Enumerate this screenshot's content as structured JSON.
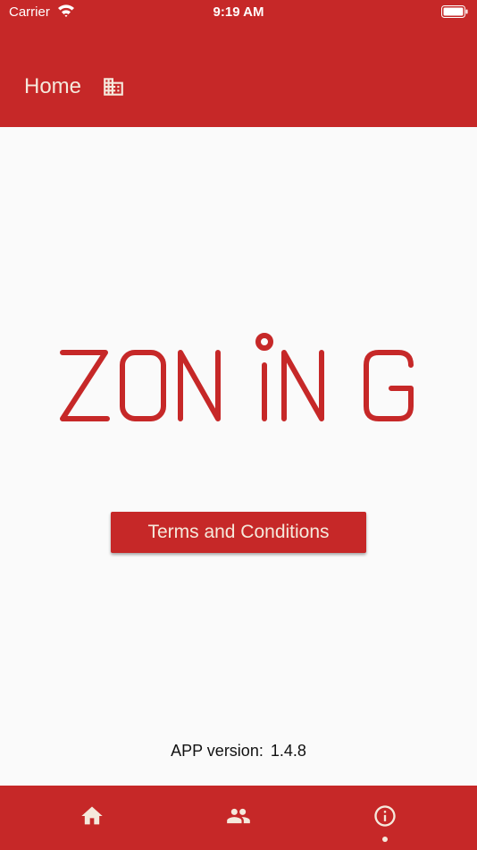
{
  "status_bar": {
    "carrier": "Carrier",
    "time": "9:19 AM"
  },
  "app_bar": {
    "title": "Home",
    "title_icon": "building-icon"
  },
  "logo": {
    "text": "ZONiNG",
    "color": "#c62828"
  },
  "terms_button": {
    "label": "Terms and Conditions"
  },
  "version": {
    "label": "APP version:",
    "value": "1.4.8"
  },
  "bottom_nav": {
    "items": [
      {
        "icon": "home-icon",
        "selected": false
      },
      {
        "icon": "people-icon",
        "selected": false
      },
      {
        "icon": "info-icon",
        "selected": true
      }
    ]
  },
  "colors": {
    "primary": "#c62828",
    "on_primary": "#f5e9dc",
    "background": "#fafafa"
  }
}
